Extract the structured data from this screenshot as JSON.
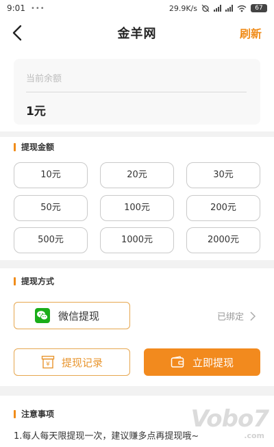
{
  "status_bar": {
    "time": "9:01",
    "network_speed": "29.9K/s",
    "battery": "67"
  },
  "header": {
    "title": "金羊网",
    "refresh_label": "刷新",
    "back_icon": "back-arrow-icon"
  },
  "balance": {
    "label": "当前余额",
    "value": "1元"
  },
  "withdraw_amount": {
    "section_title": "提现金额",
    "options": [
      "10元",
      "20元",
      "30元",
      "50元",
      "100元",
      "200元",
      "500元",
      "1000元",
      "2000元"
    ]
  },
  "withdraw_method": {
    "section_title": "提现方式",
    "wechat_label": "微信提现",
    "bound_status": "已绑定",
    "record_label": "提现记录",
    "withdraw_label": "立即提现"
  },
  "notice": {
    "section_title": "注意事项",
    "line1": "1.每人每天限提现一次，建议赚多点再提现哦~"
  },
  "watermark": {
    "text": "Vobo7",
    "sub": ".com"
  },
  "colors": {
    "accent": "#f28a1e",
    "wechat_green": "#1aad19"
  }
}
